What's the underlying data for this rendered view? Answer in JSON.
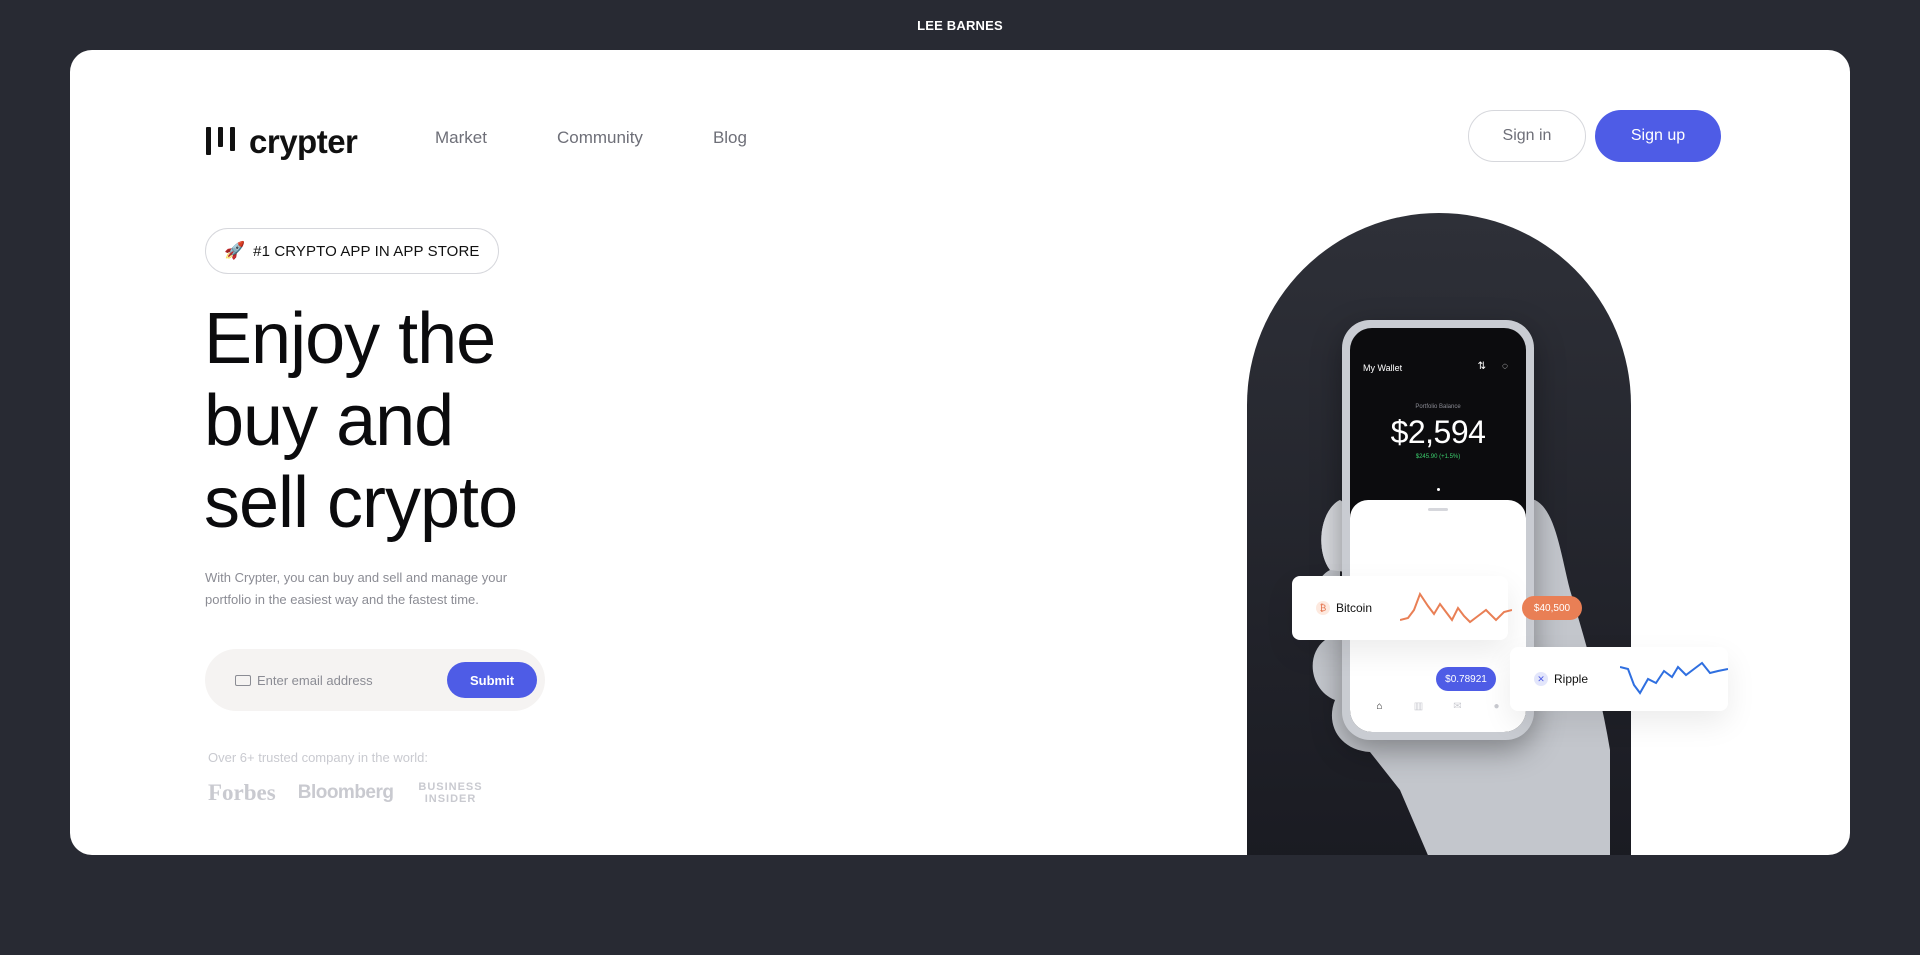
{
  "topbar": {
    "author": "LEE BARNES"
  },
  "brand": {
    "logo_text": "crypter"
  },
  "nav": {
    "items": [
      "Market",
      "Community",
      "Blog"
    ]
  },
  "auth": {
    "signin_label": "Sign in",
    "signup_label": "Sign up"
  },
  "hero": {
    "badge_icon": "🚀",
    "badge_text": "#1 CRYPTO APP IN APP STORE",
    "headline_lines": [
      "Enjoy the",
      "buy and",
      "sell crypto"
    ],
    "subtext": "With Crypter, you can buy and sell and manage your portfolio in the easiest way and the fastest time.",
    "email_placeholder": "Enter email address",
    "submit_label": "Submit",
    "trusted_text": "Over 6+ trusted company in the world:",
    "partners": [
      "Forbes",
      "Bloomberg",
      "BUSINESS INSIDER"
    ]
  },
  "phone": {
    "title": "My Wallet",
    "balance_label": "Portfolio Balance",
    "balance_value": "$2,594",
    "balance_change": "$245.90 (+1.5%)",
    "icons": [
      "swap-icon",
      "bell-icon",
      "home-icon",
      "chart-icon",
      "mail-icon",
      "user-icon"
    ]
  },
  "coins": [
    {
      "name": "Bitcoin",
      "price": "$40,500",
      "color": "#e97f55"
    },
    {
      "name": "Ripple",
      "price": "$0.78921",
      "color": "#4e5ce6"
    }
  ],
  "colors": {
    "accent": "#4e5ce6",
    "background": "#282a33",
    "bitcoin": "#e97f55"
  }
}
